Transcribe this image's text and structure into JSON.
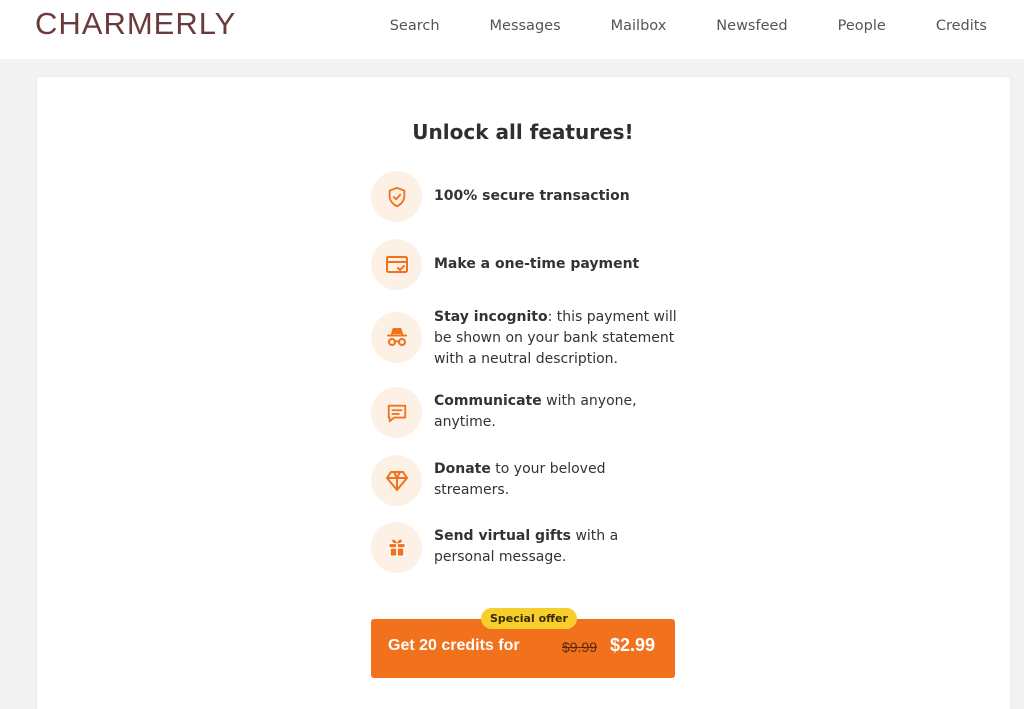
{
  "brand": {
    "logo_text": "CHARMERLY"
  },
  "nav": [
    {
      "label": "Search"
    },
    {
      "label": "Messages"
    },
    {
      "label": "Mailbox"
    },
    {
      "label": "Newsfeed"
    },
    {
      "label": "People"
    },
    {
      "label": "Credits"
    }
  ],
  "main": {
    "headline": "Unlock all features!",
    "features": [
      {
        "icon": "shield-check-icon",
        "bold": "100% secure transaction",
        "rest": ""
      },
      {
        "icon": "card-check-icon",
        "bold": "Make a one-time payment",
        "rest": ""
      },
      {
        "icon": "incognito-icon",
        "bold": "Stay incognito",
        "rest": ": this payment will be shown on your bank statement with a neutral description."
      },
      {
        "icon": "chat-icon",
        "bold": "Communicate",
        "rest": " with anyone, anytime."
      },
      {
        "icon": "diamond-icon",
        "bold": "Donate",
        "rest": " to your beloved streamers."
      },
      {
        "icon": "gift-icon",
        "bold": "Send virtual gifts",
        "rest": " with a personal message."
      }
    ],
    "offer": {
      "badge": "Special offer",
      "label": "Get 20 credits for",
      "old_price": "$9.99",
      "new_price": "$2.99"
    }
  },
  "colors": {
    "accent": "#f2711c",
    "icon_bg": "#fdf1e6",
    "badge": "#f7cf2c",
    "logo": "#6a3b3b"
  }
}
